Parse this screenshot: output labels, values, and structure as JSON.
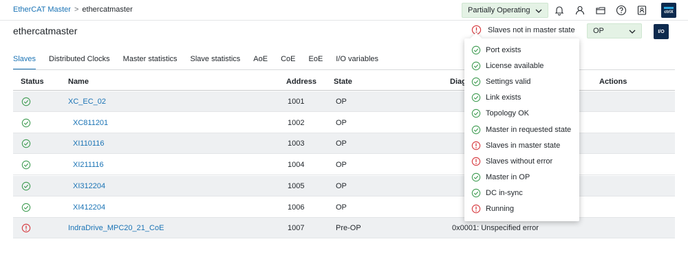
{
  "breadcrumb": {
    "parent": "EtherCAT Master",
    "separator": ">",
    "current": "ethercatmaster"
  },
  "topbar": {
    "status": "Partially Operating",
    "icons": [
      "bell-icon",
      "user-icon",
      "folder-icon",
      "help-icon",
      "address-book-icon"
    ],
    "logo_text": "ctrlX"
  },
  "header": {
    "title": "ethercatmaster",
    "warning": "Slaves not in master state",
    "state_select": "OP",
    "logo_text": "I/O"
  },
  "tabs": [
    "Slaves",
    "Distributed Clocks",
    "Master statistics",
    "Slave statistics",
    "AoE",
    "CoE",
    "EoE",
    "I/O variables"
  ],
  "active_tab": "Slaves",
  "table": {
    "columns": [
      "Status",
      "Name",
      "Address",
      "State",
      "Diag",
      "Actions"
    ],
    "rows": [
      {
        "status": "ok",
        "name": "XC_EC_02",
        "address": "1001",
        "state": "OP",
        "diag": ""
      },
      {
        "status": "ok",
        "name": "XC811201",
        "address": "1002",
        "state": "OP",
        "diag": ""
      },
      {
        "status": "ok",
        "name": "XI110116",
        "address": "1003",
        "state": "OP",
        "diag": ""
      },
      {
        "status": "ok",
        "name": "XI211116",
        "address": "1004",
        "state": "OP",
        "diag": ""
      },
      {
        "status": "ok",
        "name": "XI312204",
        "address": "1005",
        "state": "OP",
        "diag": ""
      },
      {
        "status": "ok",
        "name": "XI412204",
        "address": "1006",
        "state": "OP",
        "diag": ""
      },
      {
        "status": "error",
        "name": "IndraDrive_MPC20_21_CoE",
        "address": "1007",
        "state": "Pre-OP",
        "diag": "0x0001: Unspecified error"
      }
    ]
  },
  "checklist": [
    {
      "label": "Port exists",
      "status": "ok"
    },
    {
      "label": "License available",
      "status": "ok"
    },
    {
      "label": "Settings valid",
      "status": "ok"
    },
    {
      "label": "Link exists",
      "status": "ok"
    },
    {
      "label": "Topology OK",
      "status": "ok"
    },
    {
      "label": "Master in requested state",
      "status": "ok"
    },
    {
      "label": "Slaves in master state",
      "status": "error"
    },
    {
      "label": "Slaves without error",
      "status": "error"
    },
    {
      "label": "Master in OP",
      "status": "ok"
    },
    {
      "label": "DC in-sync",
      "status": "ok"
    },
    {
      "label": "Running",
      "status": "error"
    }
  ],
  "colors": {
    "accent": "#1a73b5",
    "ok": "#3f9c52",
    "error": "#d6353a",
    "status_bg": "#e4f2e5"
  }
}
